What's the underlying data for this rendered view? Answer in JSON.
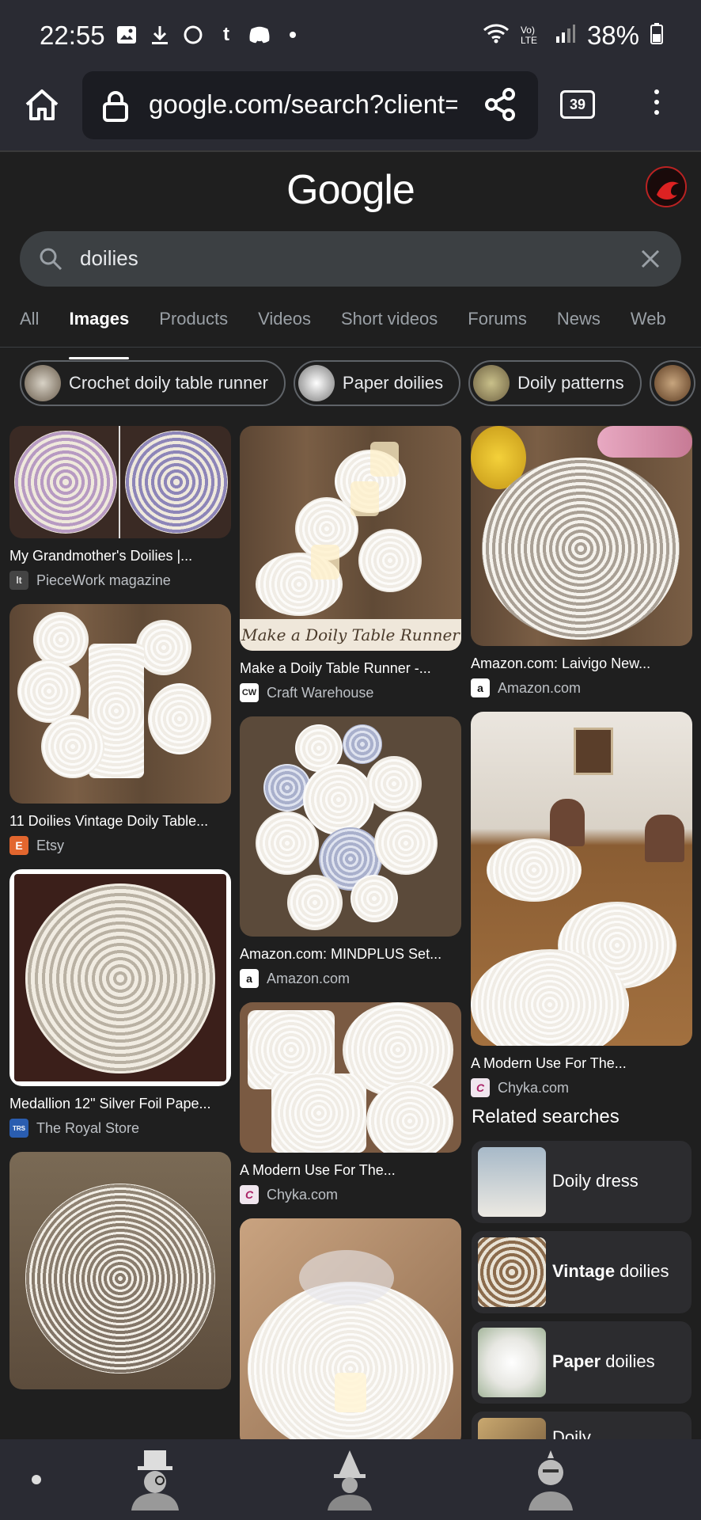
{
  "status_bar": {
    "time": "22:55",
    "battery": "38%",
    "network": "Vo) LTE"
  },
  "browser": {
    "url": "google.com/search?client=",
    "tab_count": "39"
  },
  "google": {
    "logo": "Google"
  },
  "search": {
    "query": "doilies"
  },
  "tabs": [
    {
      "label": "All",
      "active": false
    },
    {
      "label": "Images",
      "active": true
    },
    {
      "label": "Products",
      "active": false
    },
    {
      "label": "Videos",
      "active": false
    },
    {
      "label": "Short videos",
      "active": false
    },
    {
      "label": "Forums",
      "active": false
    },
    {
      "label": "News",
      "active": false
    },
    {
      "label": "Web",
      "active": false
    }
  ],
  "chips": [
    {
      "label": "Crochet doily table runner"
    },
    {
      "label": "Paper doilies"
    },
    {
      "label": "Doily patterns"
    }
  ],
  "results": {
    "col1": [
      {
        "caption": "My Grandmother's Doilies |...",
        "source": "PieceWork magazine",
        "favicon": "lt"
      },
      {
        "caption": "11 Doilies Vintage Doily Table...",
        "source": "Etsy",
        "favicon": "E"
      },
      {
        "caption": "Medallion 12\" Silver Foil Pape...",
        "source": "The Royal Store",
        "favicon": "TRS"
      },
      {
        "caption": "",
        "source": "",
        "favicon": ""
      }
    ],
    "col2": [
      {
        "caption": "Make a Doily Table Runner -...",
        "source": "Craft Warehouse",
        "favicon": "CW",
        "overlay": "Make a Doily Table Runner"
      },
      {
        "caption": "Amazon.com: MINDPLUS Set...",
        "source": "Amazon.com",
        "favicon": "a"
      },
      {
        "caption": "A Modern Use For The...",
        "source": "Chyka.com",
        "favicon": "C"
      },
      {
        "caption": "",
        "source": "",
        "favicon": ""
      }
    ],
    "col3": [
      {
        "caption": "Amazon.com: Laivigo New...",
        "source": "Amazon.com",
        "favicon": "a"
      },
      {
        "caption": "A Modern Use For The...",
        "source": "Chyka.com",
        "favicon": "C"
      }
    ]
  },
  "related": {
    "title": "Related searches",
    "items": [
      {
        "prefix": "",
        "bold": "",
        "suffix": "Doily dress"
      },
      {
        "prefix": "",
        "bold": "Vintage",
        "suffix": " doilies"
      },
      {
        "prefix": "",
        "bold": "Paper",
        "suffix": " doilies"
      },
      {
        "prefix": "",
        "bold": "",
        "suffix": "Doily"
      }
    ]
  },
  "colors": {
    "background": "#1f1f1f",
    "toolbar": "#2a2b33",
    "search_bg": "#3c4043"
  }
}
